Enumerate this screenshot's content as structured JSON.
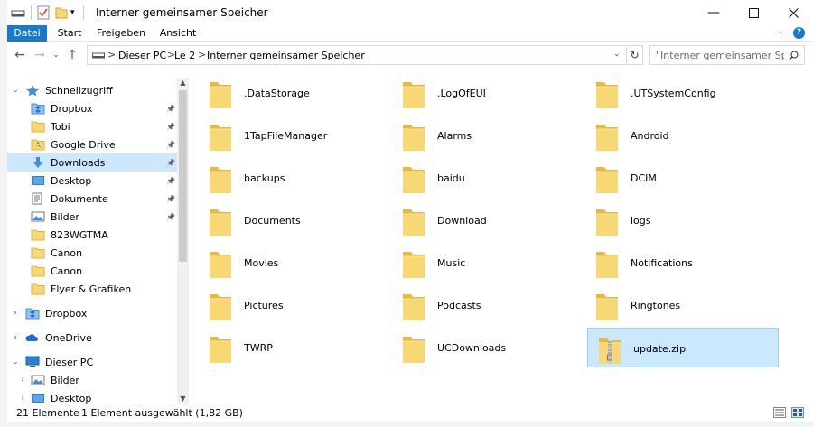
{
  "window": {
    "title": "Interner gemeinsamer Speicher"
  },
  "ribbon": {
    "tabs": [
      "Datei",
      "Start",
      "Freigeben",
      "Ansicht"
    ],
    "active_tab": "Datei",
    "accent": "#1979ca"
  },
  "address": {
    "crumbs": [
      "Dieser PC",
      "Le 2",
      "Interner gemeinsamer Speicher"
    ],
    "separator": ">"
  },
  "search": {
    "placeholder": "\"Interner gemeinsamer Speic..."
  },
  "navpane": {
    "items": [
      {
        "label": "Schnellzugriff",
        "icon": "star-icon",
        "expander": "expanded",
        "indent": 0,
        "pinned": false,
        "selected": false
      },
      {
        "label": "Dropbox",
        "icon": "dropbox-icon",
        "expander": "none",
        "indent": 1,
        "pinned": true,
        "selected": false
      },
      {
        "label": "Tobi",
        "icon": "folder-icon",
        "expander": "none",
        "indent": 1,
        "pinned": true,
        "selected": false
      },
      {
        "label": "Google Drive",
        "icon": "google-drive-icon",
        "expander": "none",
        "indent": 1,
        "pinned": true,
        "selected": false
      },
      {
        "label": "Downloads",
        "icon": "download-icon",
        "expander": "none",
        "indent": 1,
        "pinned": true,
        "selected": true
      },
      {
        "label": "Desktop",
        "icon": "desktop-icon",
        "expander": "none",
        "indent": 1,
        "pinned": true,
        "selected": false
      },
      {
        "label": "Dokumente",
        "icon": "documents-icon",
        "expander": "none",
        "indent": 1,
        "pinned": true,
        "selected": false
      },
      {
        "label": "Bilder",
        "icon": "pictures-icon",
        "expander": "none",
        "indent": 1,
        "pinned": true,
        "selected": false
      },
      {
        "label": "823WGTMA",
        "icon": "folder-icon",
        "expander": "none",
        "indent": 1,
        "pinned": false,
        "selected": false
      },
      {
        "label": "Canon",
        "icon": "folder-icon",
        "expander": "none",
        "indent": 1,
        "pinned": false,
        "selected": false
      },
      {
        "label": "Canon",
        "icon": "folder-icon",
        "expander": "none",
        "indent": 1,
        "pinned": false,
        "selected": false
      },
      {
        "label": "Flyer & Grafiken",
        "icon": "folder-icon",
        "expander": "none",
        "indent": 1,
        "pinned": false,
        "selected": false
      },
      {
        "label": "Dropbox",
        "icon": "dropbox-icon",
        "expander": "collapsed",
        "indent": 0,
        "pinned": false,
        "selected": false
      },
      {
        "label": "OneDrive",
        "icon": "onedrive-icon",
        "expander": "collapsed",
        "indent": 0,
        "pinned": false,
        "selected": false
      },
      {
        "label": "Dieser PC",
        "icon": "computer-icon",
        "expander": "expanded",
        "indent": 0,
        "pinned": false,
        "selected": false
      },
      {
        "label": "Bilder",
        "icon": "pictures-icon",
        "expander": "collapsed",
        "indent": 1,
        "pinned": false,
        "selected": false
      },
      {
        "label": "Desktop",
        "icon": "desktop-icon",
        "expander": "collapsed",
        "indent": 1,
        "pinned": false,
        "selected": false
      }
    ]
  },
  "files": [
    {
      "name": ".DataStorage",
      "type": "folder",
      "selected": false
    },
    {
      "name": ".LogOfEUI",
      "type": "folder",
      "selected": false
    },
    {
      "name": ".UTSystemConfig",
      "type": "folder",
      "selected": false
    },
    {
      "name": "1TapFileManager",
      "type": "folder",
      "selected": false
    },
    {
      "name": "Alarms",
      "type": "folder",
      "selected": false
    },
    {
      "name": "Android",
      "type": "folder",
      "selected": false
    },
    {
      "name": "backups",
      "type": "folder",
      "selected": false
    },
    {
      "name": "baidu",
      "type": "folder",
      "selected": false
    },
    {
      "name": "DCIM",
      "type": "folder",
      "selected": false
    },
    {
      "name": "Documents",
      "type": "folder",
      "selected": false
    },
    {
      "name": "Download",
      "type": "folder",
      "selected": false
    },
    {
      "name": "logs",
      "type": "folder",
      "selected": false
    },
    {
      "name": "Movies",
      "type": "folder",
      "selected": false
    },
    {
      "name": "Music",
      "type": "folder",
      "selected": false
    },
    {
      "name": "Notifications",
      "type": "folder",
      "selected": false
    },
    {
      "name": "Pictures",
      "type": "folder",
      "selected": false
    },
    {
      "name": "Podcasts",
      "type": "folder",
      "selected": false
    },
    {
      "name": "Ringtones",
      "type": "folder",
      "selected": false
    },
    {
      "name": "TWRP",
      "type": "folder",
      "selected": false
    },
    {
      "name": "UCDownloads",
      "type": "folder",
      "selected": false
    },
    {
      "name": "update.zip",
      "type": "zip",
      "selected": true
    }
  ],
  "status": {
    "count": "21 Elemente",
    "selection": "1 Element ausgewählt (1,82 GB)"
  },
  "colors": {
    "folder": "#f8d775",
    "folder_dark": "#e9b93f",
    "selection": "#cce8ff"
  }
}
